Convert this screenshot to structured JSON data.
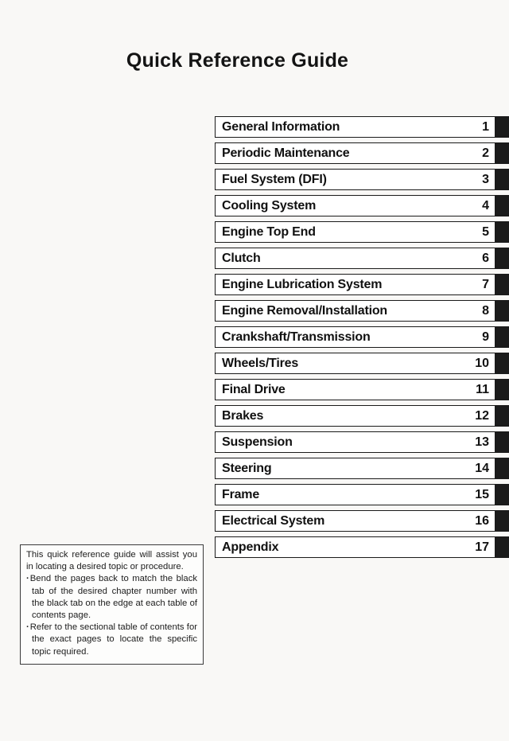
{
  "page": {
    "title": "Quick Reference Guide"
  },
  "chapters": [
    {
      "name": "General Information",
      "number": "1"
    },
    {
      "name": "Periodic Maintenance",
      "number": "2"
    },
    {
      "name": "Fuel System (DFI)",
      "number": "3"
    },
    {
      "name": "Cooling System",
      "number": "4"
    },
    {
      "name": "Engine Top End",
      "number": "5"
    },
    {
      "name": "Clutch",
      "number": "6"
    },
    {
      "name": "Engine Lubrication System",
      "number": "7"
    },
    {
      "name": "Engine Removal/Installation",
      "number": "8"
    },
    {
      "name": "Crankshaft/Transmission",
      "number": "9"
    },
    {
      "name": "Wheels/Tires",
      "number": "10"
    },
    {
      "name": "Final Drive",
      "number": "11"
    },
    {
      "name": "Brakes",
      "number": "12"
    },
    {
      "name": "Suspension",
      "number": "13"
    },
    {
      "name": "Steering",
      "number": "14"
    },
    {
      "name": "Frame",
      "number": "15"
    },
    {
      "name": "Electrical System",
      "number": "16"
    },
    {
      "name": "Appendix",
      "number": "17"
    }
  ],
  "note": {
    "intro": "This quick reference guide will assist you in locating a desired topic or procedure.",
    "bullets": [
      "Bend the pages back to match the black tab of the desired chapter number with the black tab on the edge at each table of contents page.",
      "Refer to the sectional table of contents for the exact pages to locate the specific topic required."
    ]
  },
  "colors": {
    "tab": "#1b1b1b",
    "border": "#1a1a1a",
    "page_background": "#f9f8f6"
  }
}
